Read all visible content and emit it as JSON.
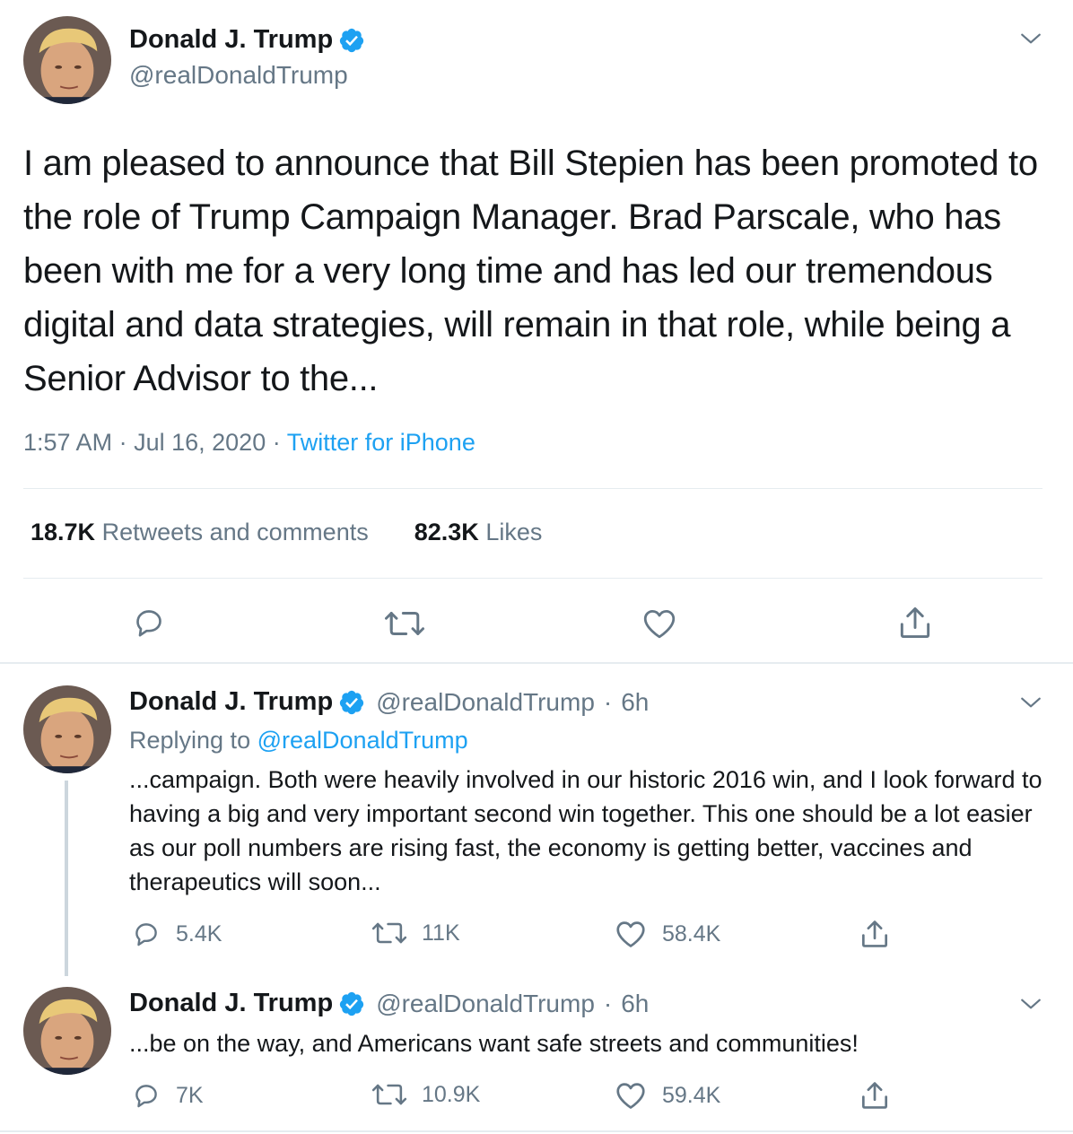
{
  "main_tweet": {
    "name": "Donald J. Trump",
    "handle": "@realDonaldTrump",
    "text": "I am pleased to announce that Bill Stepien has been promoted to the role of Trump Campaign Manager. Brad Parscale, who has been with me for a very long time and has led our tremendous digital and data strategies, will remain in that role, while being a Senior Advisor to the...",
    "time": "1:57 AM",
    "date": "Jul 16, 2020",
    "separator": "·",
    "source": "Twitter for iPhone",
    "retweets_count": "18.7K",
    "retweets_label": "Retweets and comments",
    "likes_count": "82.3K",
    "likes_label": "Likes"
  },
  "replies": [
    {
      "name": "Donald J. Trump",
      "handle": "@realDonaldTrump",
      "time_ago": "6h",
      "separator": "·",
      "replying_prefix": "Replying to",
      "replying_to": "@realDonaldTrump",
      "text": "...campaign. Both were heavily involved in our historic 2016 win, and I look forward to having a big and very important second win together. This one should be a lot easier as our poll numbers are rising fast, the economy is getting better, vaccines and therapeutics will soon...",
      "reply_count": "5.4K",
      "retweet_count": "11K",
      "like_count": "58.4K"
    },
    {
      "name": "Donald J. Trump",
      "handle": "@realDonaldTrump",
      "time_ago": "6h",
      "separator": "·",
      "text": "...be on the way, and Americans want safe streets and communities!",
      "reply_count": "7K",
      "retweet_count": "10.9K",
      "like_count": "59.4K"
    }
  ],
  "colors": {
    "accent": "#1da1f2",
    "secondary_text": "#657786",
    "primary_text": "#14171a",
    "divider": "#e6ecf0"
  },
  "icons": [
    "verified-badge-icon",
    "chevron-down-icon",
    "reply-icon",
    "retweet-icon",
    "like-icon",
    "share-icon"
  ]
}
